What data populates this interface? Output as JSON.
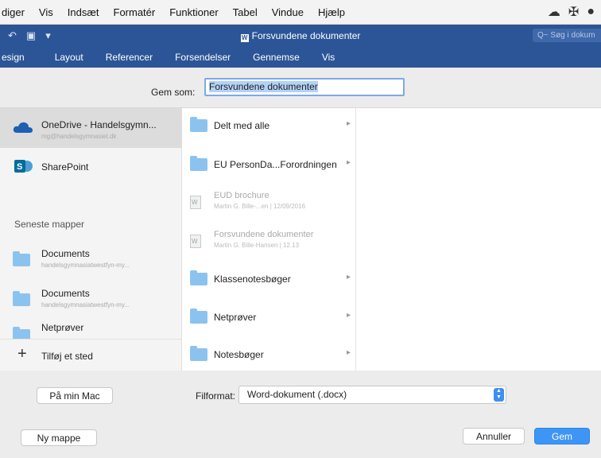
{
  "menubar": {
    "items": [
      "diger",
      "Vis",
      "Indsæt",
      "Formatér",
      "Funktioner",
      "Tabel",
      "Vindue",
      "Hjælp"
    ],
    "status_icons": [
      "cloud-icon",
      "app-icon",
      "user-icon"
    ]
  },
  "titlebar": {
    "title": "Forsvundene dokumenter",
    "qat": [
      "↶",
      "💾",
      "▾"
    ],
    "search_placeholder": "Q~ Søg i dokum"
  },
  "ribbon": {
    "tabs": [
      "esign",
      "Layout",
      "Referencer",
      "Forsendelser",
      "Gennemse",
      "Vis"
    ]
  },
  "save": {
    "label": "Gem som:",
    "filename": "Forsvundene dokumenter"
  },
  "sidebar": {
    "items": [
      {
        "title": "OneDrive - Handelsgymn...",
        "sub": "mg@handelsgymnasiet.dk"
      },
      {
        "title": "SharePoint",
        "sub": ""
      }
    ],
    "recent_heading": "Seneste mapper",
    "recent": [
      {
        "title": "Documents",
        "sub": "handelsgymnasiatwestfyn-my..."
      },
      {
        "title": "Documents",
        "sub": "handelsgymnasiatwestfyn-my..."
      },
      {
        "title": "Netprøver",
        "sub": ""
      }
    ],
    "add_place": "Tilføj et sted"
  },
  "files": [
    {
      "name": "Delt med alle",
      "type": "folder",
      "meta": "",
      "chevron": "▸"
    },
    {
      "name": "EU PersonDa...Forordningen",
      "type": "folder",
      "meta": "",
      "chevron": "▸"
    },
    {
      "name": "EUD brochure",
      "type": "doc",
      "meta": "Martin G. Bille-...en | 12/09/2016",
      "chevron": ""
    },
    {
      "name": "Forsvundene dokumenter",
      "type": "doc",
      "meta": "Martin G. Bille-Hansen | 12.13",
      "chevron": ""
    },
    {
      "name": "Klassenotesbøger",
      "type": "folder",
      "meta": "",
      "chevron": "▸"
    },
    {
      "name": "Netprøver",
      "type": "folder",
      "meta": "",
      "chevron": "▸"
    },
    {
      "name": "Notesbøger",
      "type": "folder",
      "meta": "",
      "chevron": "▸"
    }
  ],
  "bottom": {
    "on_my_mac": "På min Mac",
    "format_label": "Filformat:",
    "format_value": "Word-dokument (.docx)",
    "new_folder": "Ny mappe",
    "cancel": "Annuller",
    "save": "Gem"
  },
  "colors": {
    "word_blue": "#2c5597",
    "accent": "#3d95f5",
    "folder": "#8cc3ee"
  }
}
